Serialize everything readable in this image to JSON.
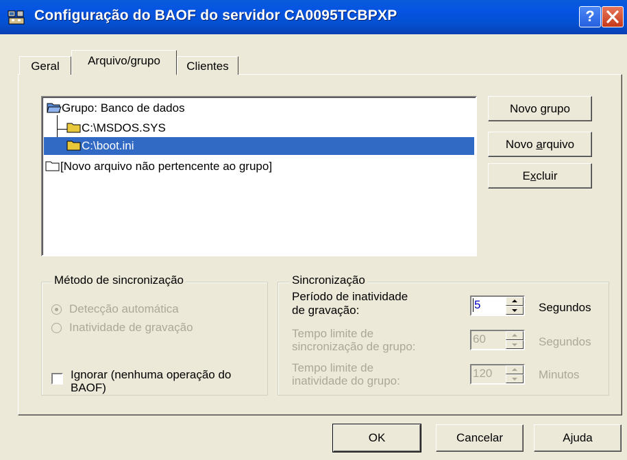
{
  "window": {
    "title": "Configuração do BAOF do servidor CA0095TCBPXP",
    "help_label": "?"
  },
  "tabs": [
    "Geral",
    "Arquivo/grupo",
    "Clientes"
  ],
  "tree": {
    "group_label": "Grupo: Banco de dados",
    "items": [
      "C:\\MSDOS.SYS",
      "C:\\boot.ini"
    ],
    "selected_index": 1,
    "new_file_label": "[Novo arquivo não pertencente ao grupo]"
  },
  "side_buttons": {
    "new_group": {
      "pre": "Novo ",
      "key": "g",
      "post": "rupo"
    },
    "new_file": {
      "pre": "Novo ",
      "key": "a",
      "post": "rquivo"
    },
    "delete": {
      "pre": "E",
      "key": "x",
      "post": "cluir"
    }
  },
  "sync_method": {
    "title": "Método de sincronização",
    "auto_detect": "Detecção automática",
    "write_inactivity": "Inatividade de gravação",
    "ignore_line1": "Ignorar (nenhuma operação do",
    "ignore_line2": "BAOF)"
  },
  "sync": {
    "title": "Sincronização",
    "inactivity_label_1": "Período de inatividade",
    "inactivity_label_2": "de gravação:",
    "inactivity_value": "5",
    "inactivity_unit": "Segundos",
    "group_timeout_label_1": "Tempo limite de",
    "group_timeout_label_2": "sincronização de grupo:",
    "group_timeout_value": "60",
    "group_timeout_unit": "Segundos",
    "group_inactivity_label_1": "Tempo limite de",
    "group_inactivity_label_2": "inatividade do grupo:",
    "group_inactivity_value": "120",
    "group_inactivity_unit": "Minutos"
  },
  "footer": {
    "ok": "OK",
    "cancel": "Cancelar",
    "help": "Ajuda"
  },
  "colors": {
    "titlebar": "#0554e3",
    "selection": "#316ac5",
    "dialog_bg": "#ece9d8",
    "folder_yellow": "#e8c83a"
  }
}
